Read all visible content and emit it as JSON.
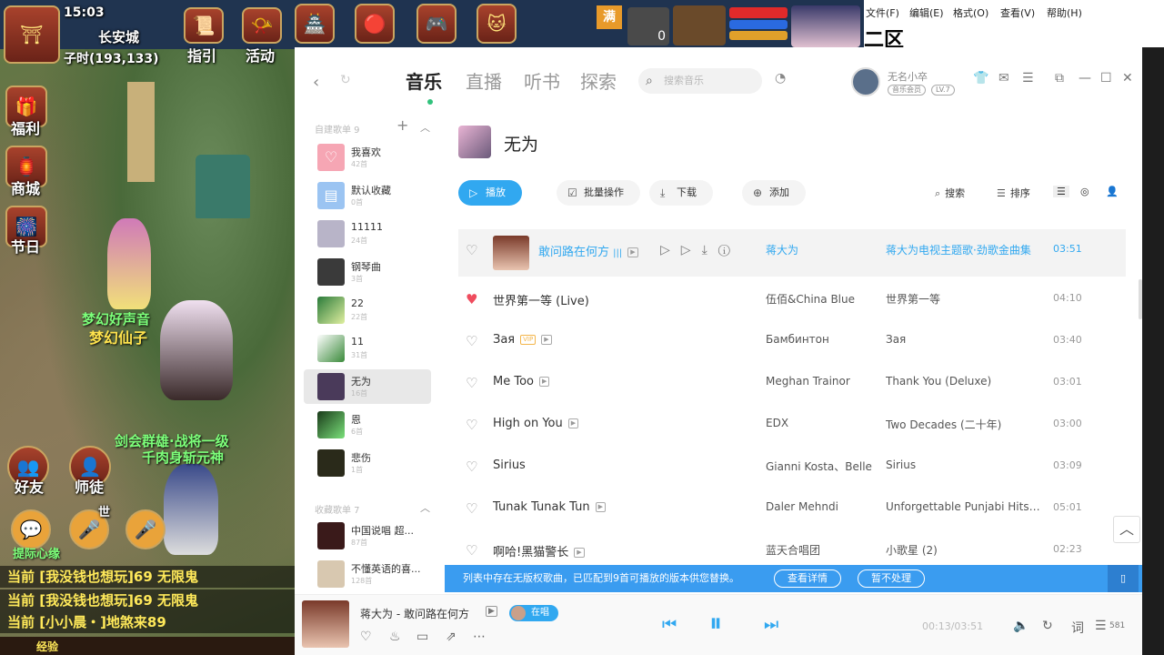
{
  "game": {
    "clock": "15:03",
    "location": "长安城",
    "coords": "子时(193,133)",
    "guide": "指引",
    "activity": "活动",
    "welfare": "福利",
    "shop": "商城",
    "festival": "节日",
    "server": "二区",
    "badge_full": "满",
    "num_zero": "0",
    "npc_name_1": "梦幻好声音",
    "npc_name_2": "梦幻仙子",
    "event_1": "剑会群雄·战将一级",
    "event_2": "千肉身斩元神",
    "friends": "好友",
    "master": "师徒",
    "world": "世",
    "chat_lines": [
      "当前 [我没钱也想玩]69  无限鬼",
      "当前 [我没钱也想玩]69  无限鬼",
      "当前 [小小晨・]地煞来89"
    ],
    "xp": "经验",
    "npc_sub": "提际心缘"
  },
  "notepad": {
    "menu": [
      "文件(F)",
      "编辑(E)",
      "格式(O)",
      "查看(V)",
      "帮助(H)"
    ]
  },
  "app": {
    "tabs": [
      "音乐",
      "直播",
      "听书",
      "探索"
    ],
    "search_placeholder": "搜索音乐",
    "user_name": "无名小卒",
    "user_badge_1": "音乐会员",
    "user_badge_2": "LV.7",
    "sidebar": {
      "created_header": "自建歌单 9",
      "collected_header": "收藏歌单 7",
      "playlists": [
        {
          "name": "我喜欢",
          "count": "42首"
        },
        {
          "name": "默认收藏",
          "count": "0首"
        },
        {
          "name": "11111",
          "count": "24首"
        },
        {
          "name": "钢琴曲",
          "count": "3首"
        },
        {
          "name": "22",
          "count": "22首"
        },
        {
          "name": "11",
          "count": "31首"
        },
        {
          "name": "无为",
          "count": "16首"
        },
        {
          "name": "恩",
          "count": "6首"
        },
        {
          "name": "悲伤",
          "count": "1首"
        }
      ],
      "collected": [
        {
          "name": "中国说唱 超...",
          "count": "87首"
        },
        {
          "name": "不懂英语的喜...",
          "count": "128首"
        }
      ]
    },
    "playlist_title": "无为",
    "buttons": {
      "play": "播放",
      "batch": "批量操作",
      "download": "下载",
      "add": "添加",
      "search": "搜索",
      "sort": "排序"
    },
    "songs": [
      {
        "title": "敢问路在何方",
        "artist": "蒋大为",
        "album": "蒋大为电视主题歌·劲歌金曲集",
        "duration": "03:51",
        "liked": false,
        "active": true,
        "mv": true
      },
      {
        "title": "世界第一等 (Live)",
        "artist": "伍佰&China Blue",
        "album": "世界第一等",
        "duration": "04:10",
        "liked": true
      },
      {
        "title": "Зая",
        "artist": "Бамбинтон",
        "album": "Зая",
        "duration": "03:40",
        "vip": true,
        "mv": true
      },
      {
        "title": "Me Too",
        "artist": "Meghan Trainor",
        "album": "Thank You (Deluxe)",
        "duration": "03:01",
        "mv": true
      },
      {
        "title": "High on You",
        "artist": "EDX",
        "album": "Two Decades (二十年)",
        "duration": "03:00",
        "mv": true
      },
      {
        "title": "Sirius",
        "artist": "Gianni Kosta、Belle",
        "album": "Sirius",
        "duration": "03:09"
      },
      {
        "title": "Tunak Tunak Tun",
        "artist": "Daler Mehndi",
        "album": "Unforgettable Punjabi Hits Of...",
        "duration": "05:01",
        "mv": true
      },
      {
        "title": "啊哈!黑猫警长",
        "artist": "蓝天合唱团",
        "album": "小歌星 (2)",
        "duration": "02:23",
        "mv": true
      }
    ],
    "notice": {
      "text": "列表中存在无版权歌曲，已匹配到9首可播放的版本供您替换。",
      "details": "查看详情",
      "ignore": "暂不处理"
    },
    "player": {
      "now_playing": "蒋大为 - 敢问路在何方",
      "live_label": "在唱",
      "time": "00:13/03:51",
      "lyrics": "词",
      "count": "581"
    }
  }
}
